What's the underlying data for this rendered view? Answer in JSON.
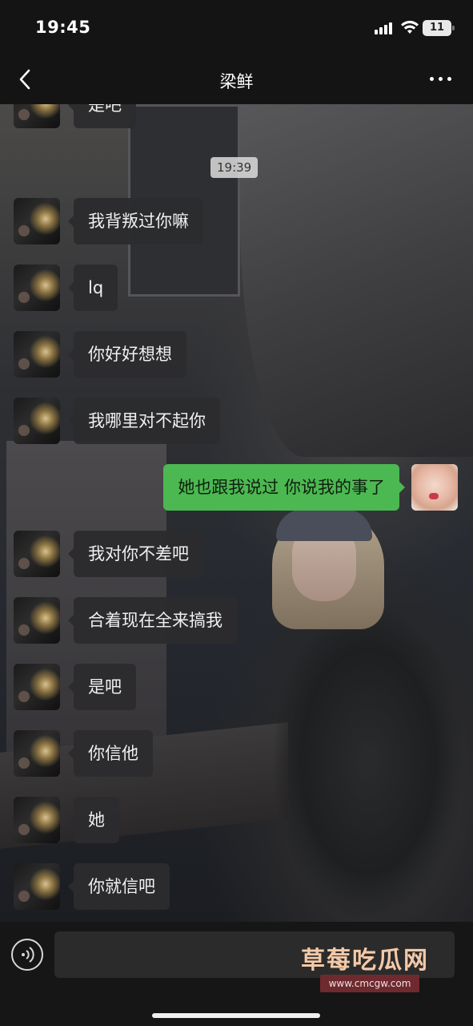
{
  "status_bar": {
    "time": "19:45",
    "battery": "11"
  },
  "header": {
    "title": "梁鲜"
  },
  "chat": {
    "timestamp": "19:39",
    "messages": [
      {
        "from": "other",
        "text": "是吧"
      },
      {
        "from": "other",
        "text": "我背叛过你嘛"
      },
      {
        "from": "other",
        "text": "lq"
      },
      {
        "from": "other",
        "text": "你好好想想"
      },
      {
        "from": "other",
        "text": "我哪里对不起你"
      },
      {
        "from": "self",
        "text": "她也跟我说过 你说我的事了"
      },
      {
        "from": "other",
        "text": "我对你不差吧"
      },
      {
        "from": "other",
        "text": "合着现在全来搞我"
      },
      {
        "from": "other",
        "text": "是吧"
      },
      {
        "from": "other",
        "text": "你信他"
      },
      {
        "from": "other",
        "text": "她"
      },
      {
        "from": "other",
        "text": "你就信吧"
      }
    ]
  },
  "input_bar": {
    "placeholder": ""
  },
  "watermark": {
    "title": "草莓吃瓜网",
    "url": "www.cmcgw.com"
  },
  "icons": {
    "back": "chevron-left-icon",
    "more": "more-dots-icon",
    "voice": "voice-icon"
  },
  "colors": {
    "outgoing_bubble": "#4cb851",
    "incoming_bubble": "#2c2c2e",
    "bar_background": "#141414"
  }
}
